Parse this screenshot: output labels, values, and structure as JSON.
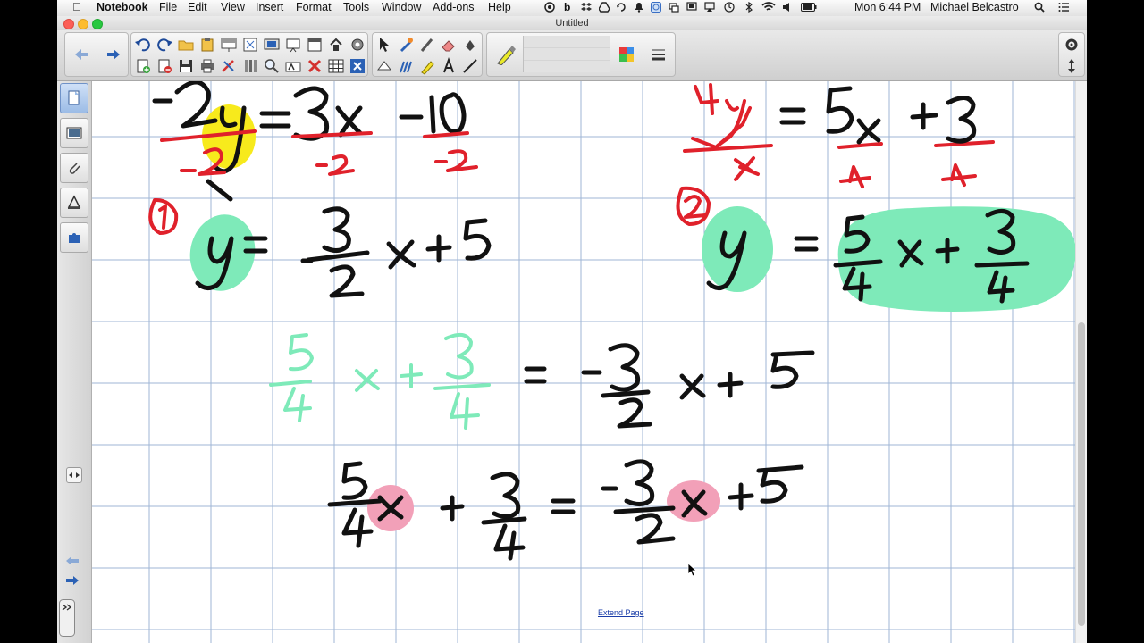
{
  "menubar": {
    "app": "Notebook",
    "items": [
      "File",
      "Edit",
      "View",
      "Insert",
      "Format",
      "Tools",
      "Window",
      "Add-ons",
      "Help"
    ],
    "clock": "Mon 6:44 PM",
    "user": "Michael Belcastro"
  },
  "window": {
    "title": "Untitled"
  },
  "page": {
    "extend_label": "Extend Page"
  },
  "colors": {
    "ink": "#111111",
    "red": "#e0212b",
    "green": "#7eeab9",
    "yellow": "#f7ea1c",
    "pink": "#f2a0b8",
    "grid": "#9fb6d6"
  },
  "math": {
    "eq1": {
      "top_left": "-2y",
      "equals": "=",
      "term_a": "3x",
      "term_b": "-10",
      "divisors": [
        "-2",
        "-2",
        "-2"
      ],
      "circle_label": "1"
    },
    "eq1_solved": {
      "lhs": "y",
      "equals": "=",
      "coef_num": "3",
      "coef_den": "2",
      "sign": "-",
      "var": "x",
      "const": "+5"
    },
    "eq2": {
      "lhs": "4y",
      "equals": "=",
      "term_a": "5x",
      "term_b": "+3",
      "divisors": [
        "4",
        "4",
        "4"
      ],
      "circle_label": "2"
    },
    "eq2_solved": {
      "lhs": "y",
      "equals": "=",
      "coef_num": "5",
      "coef_den": "4",
      "var": "x",
      "plus": "+",
      "const_num": "3",
      "const_den": "4"
    },
    "row3": {
      "a_num": "5",
      "a_den": "4",
      "var": "x",
      "plus": "+",
      "b_num": "3",
      "b_den": "4",
      "equals": "=",
      "sign": "-",
      "c_num": "3",
      "c_den": "2",
      "var2": "x",
      "const": "+5"
    },
    "row4": {
      "a_num": "5",
      "a_den": "4",
      "var": "x",
      "plus": "+",
      "b_num": "3",
      "b_den": "4",
      "equals": "=",
      "sign": "-",
      "c_num": "3",
      "c_den": "2",
      "var2": "x",
      "const": "+5"
    }
  }
}
